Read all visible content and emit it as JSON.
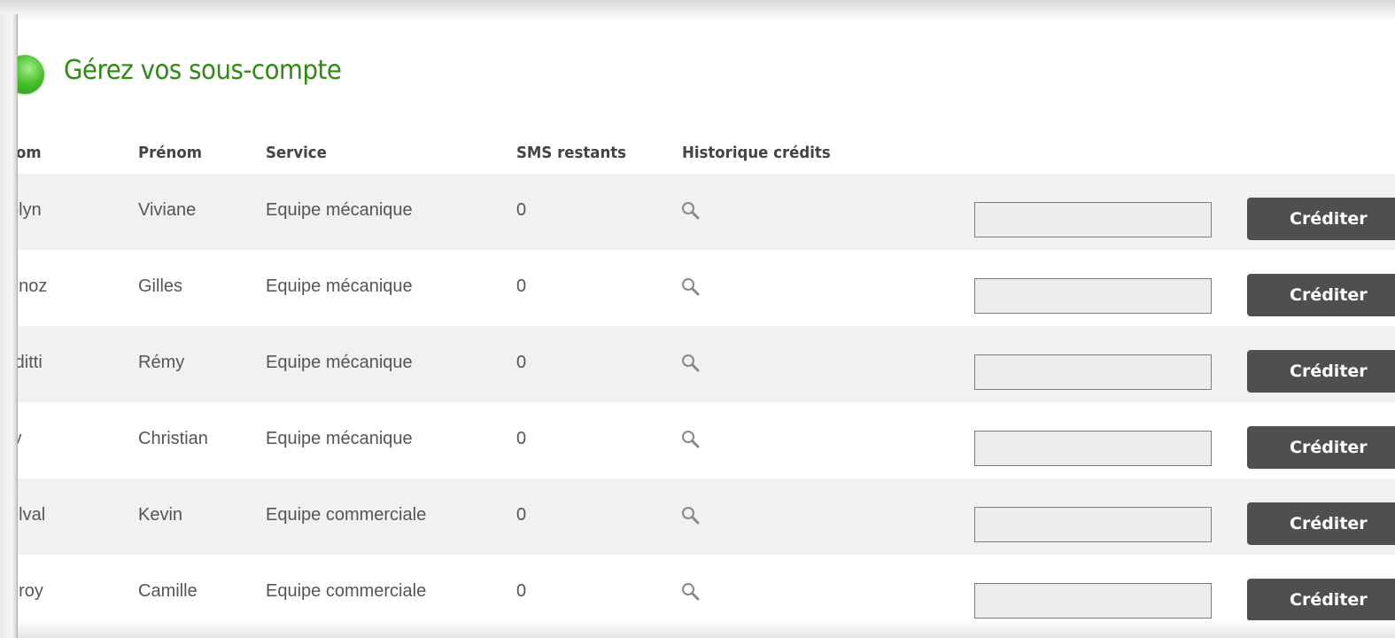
{
  "title": "Gérez vos sous-compte",
  "columns": {
    "nom": "om",
    "prenom": "Prénom",
    "service": "Service",
    "sms": "SMS restants",
    "historique": "Historique crédits"
  },
  "rows": [
    {
      "nom": "olyn",
      "prenom": "Viviane",
      "service": "Equipe mécanique",
      "sms": "0",
      "button": "Créditer",
      "input_value": ""
    },
    {
      "nom": "unoz",
      "prenom": "Gilles",
      "service": "Equipe mécanique",
      "sms": "0",
      "button": "Créditer",
      "input_value": ""
    },
    {
      "nom": "rditti",
      "prenom": "Rémy",
      "service": "Equipe mécanique",
      "sms": "0",
      "button": "Créditer",
      "input_value": ""
    },
    {
      "nom": "ly",
      "prenom": "Christian",
      "service": "Equipe mécanique",
      "sms": "0",
      "button": "Créditer",
      "input_value": ""
    },
    {
      "nom": "elval",
      "prenom": "Kevin",
      "service": "Equipe commerciale",
      "sms": "0",
      "button": "Créditer",
      "input_value": ""
    },
    {
      "nom": "eroy",
      "prenom": "Camille",
      "service": "Equipe commerciale",
      "sms": "0",
      "button": "Créditer",
      "input_value": ""
    }
  ],
  "icons": {
    "title_bullet": "green-bullet-icon",
    "history": "search-icon"
  },
  "colors": {
    "title": "#2e8b14",
    "button_bg": "#4f4f4f",
    "row_shade": "#f1f1f1"
  }
}
